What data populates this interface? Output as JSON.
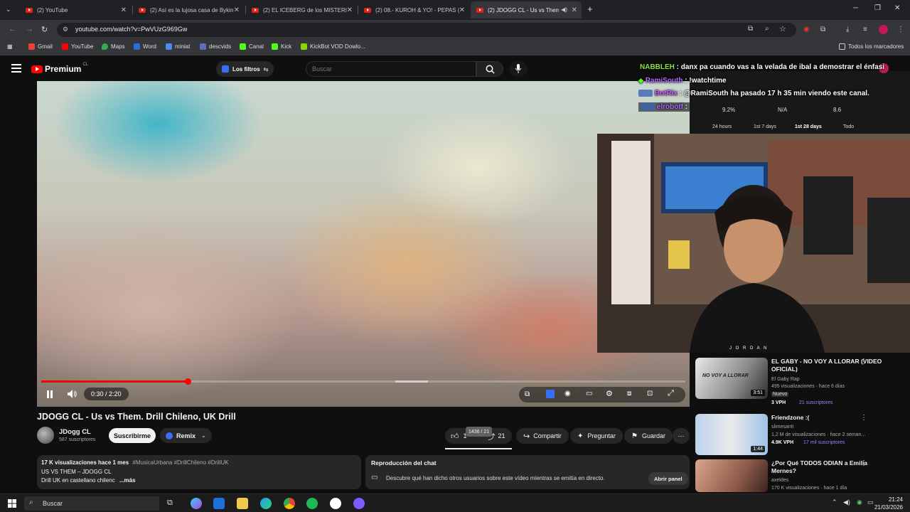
{
  "browser": {
    "tabs": [
      {
        "title": "(2) YouTube",
        "active": false
      },
      {
        "title": "(2) Así es la lujosa casa de Bykin",
        "active": false
      },
      {
        "title": "(2) EL ICEBERG de los MISTERIO",
        "active": false
      },
      {
        "title": "(2) 08.- KUROH & YO! - PEPAS (",
        "active": false
      },
      {
        "title": "(2) JDOGG CL - Us vs Them",
        "active": true
      }
    ],
    "new_tab": "+",
    "url": "youtube.com/watch?v=PwVUzG969Gw",
    "bookmarks": [
      "Gmail",
      "YouTube",
      "Maps",
      "Word",
      "miniat",
      "descvids",
      "Canal",
      "Kick",
      "KickBot VOD Dowlo..."
    ],
    "all_bookmarks": "Todos los marcadores"
  },
  "youtube": {
    "logo_text": "Premium",
    "logo_region": "CL",
    "filters_label": "Los filtros",
    "search_placeholder": "Buscar"
  },
  "player": {
    "progress_fraction": 0.227,
    "buffered_start_fraction": 0.55,
    "time": "0:30 / 2:20"
  },
  "video": {
    "title": "JDOGG CL - Us vs Them. Drill Chileno, UK Drill",
    "channel": "JDogg CL",
    "subscribers": "587 suscriptores",
    "subscribe_label": "Suscribirme",
    "remix_label": "Remix",
    "likes": "1",
    "dislikes": "21",
    "like_tooltip": "1436 / 21",
    "share_label": "Compartir",
    "ask_label": "Preguntar",
    "save_label": "Guardar",
    "more_label": "⋯"
  },
  "description": {
    "meta": "17 K visualizaciones  hace 1 mes",
    "tags": "#MusicaUrbana #DrillChileno #DrillUK",
    "line1": "US VS THEM – JDOGG CL",
    "line2": "Drill UK en castellano chilenc",
    "more": "...más"
  },
  "chat_replay": {
    "title": "Reproducción del chat",
    "text": "Descubre qué han dicho otros usuarios sobre este vídeo mientras se emitía en directo.",
    "button": "Abrir panel"
  },
  "overlay": {
    "chat": [
      {
        "user": "NABBLEH",
        "sep": ":",
        "msg": "danx pa cuando vas a la velada de ibal a demostrar el énfasi",
        "color": "#8de045"
      },
      {
        "user": "RamiSouth",
        "sep": ":",
        "msg": "!watchtime",
        "color": "#b36aff"
      },
      {
        "user": "BotRix",
        "sep": ":",
        "msg": "@RamiSouth ha pasado 17 h 35 min viendo este canal.",
        "color": "#c95cff"
      },
      {
        "user": "elrobotf",
        "sep": ":",
        "msg": "",
        "color": "#b36aff"
      }
    ],
    "stats": {
      "values": [
        "9.2%",
        "N/A",
        "8.6"
      ],
      "ranges": [
        "24 hours",
        "1st 7 days",
        "1st 28 days",
        "Todo"
      ],
      "selected_range": "1st 28 days"
    },
    "webcam_caption": "J O R D A N"
  },
  "recommendations": [
    {
      "title": "EL GABY - NO VOY A LLORAR (VIDEO OFICIAL)",
      "channel": "El Gaby Rap",
      "meta": "495 visualizaciones · hace 6 días",
      "badge": "Nuevo",
      "vph": "3 VPH",
      "extra": "21 suscriptores",
      "duration": "3:51",
      "thumb_text": "NO VOY A LLORAR"
    },
    {
      "title": "Friendzone :(",
      "channel": "slimesanti",
      "meta": "1,2 M de visualizaciones · hace 2 seman...",
      "badge": "",
      "vph": "4.9K VPH",
      "extra": "17 mil suscriptores",
      "duration": "1:44",
      "thumb_text": ""
    },
    {
      "title": "¿Por Qué TODOS ODIAN a Emilia Mernes?",
      "channel": "axeldes",
      "meta": "170 K visualizaciones · hace 1 día",
      "badge": "",
      "vph": "",
      "extra": "",
      "duration": "",
      "thumb_text": ""
    }
  ],
  "taskbar": {
    "search_placeholder": "Buscar",
    "time": "21:24",
    "date": "21/03/2026"
  },
  "colors": {
    "accent_red": "#ff0000",
    "page_bg": "#0f0f0f"
  }
}
